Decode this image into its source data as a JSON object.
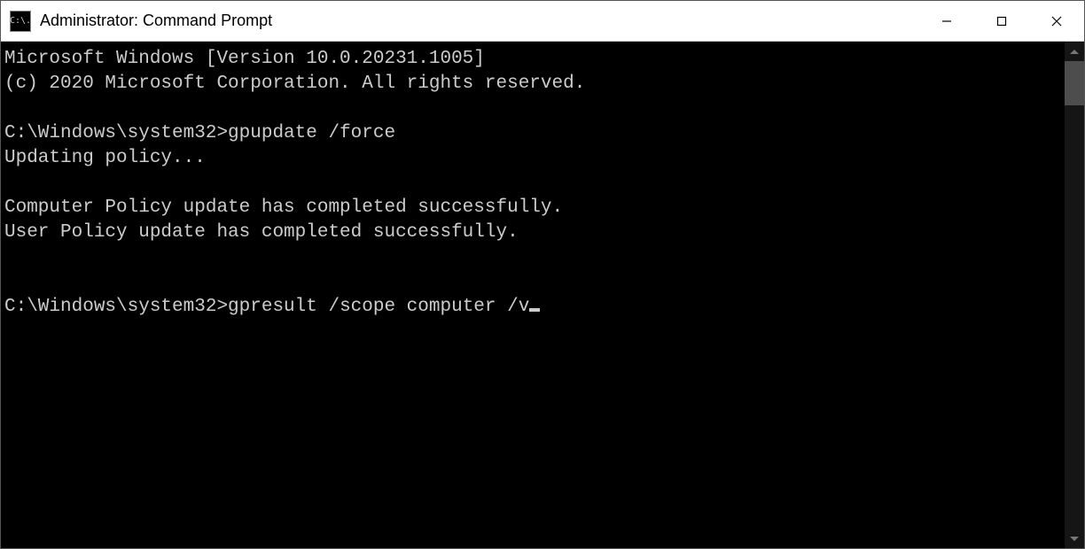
{
  "window": {
    "icon_text": "C:\\.",
    "title": "Administrator: Command Prompt"
  },
  "terminal": {
    "lines": [
      "Microsoft Windows [Version 10.0.20231.1005]",
      "(c) 2020 Microsoft Corporation. All rights reserved."
    ],
    "prompt1": "C:\\Windows\\system32>",
    "command1": "gpupdate /force",
    "output1": "Updating policy...",
    "output2": "Computer Policy update has completed successfully.",
    "output3": "User Policy update has completed successfully.",
    "prompt2": "C:\\Windows\\system32>",
    "command2": "gpresult /scope computer /v"
  }
}
